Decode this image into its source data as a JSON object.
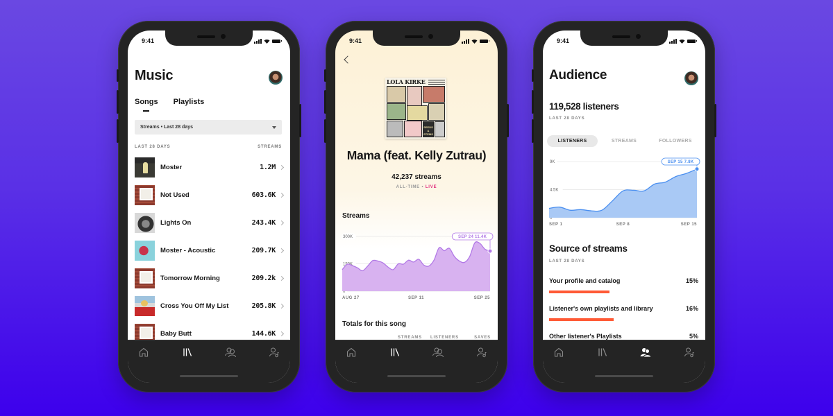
{
  "colors": {
    "accent_purple": "#b279e6",
    "accent_blue": "#4a8ff0",
    "accent_orange": "#ff5a36",
    "live_pink": "#e0287a",
    "tabbar": "#242424"
  },
  "status_bar": {
    "time": "9:41"
  },
  "tabbar_icons": [
    "home-icon",
    "library-icon",
    "audience-icon",
    "profile-icon"
  ],
  "music_screen": {
    "title": "Music",
    "tabs": [
      {
        "label": "Songs",
        "active": true
      },
      {
        "label": "Playlists",
        "active": false
      }
    ],
    "filter": {
      "value": "Streams • Last 28 days"
    },
    "list_header": {
      "left": "LAST 28 DAYS",
      "right": "STREAMS"
    },
    "songs": [
      {
        "name": "Moster",
        "streams": "1.2M"
      },
      {
        "name": "Not Used",
        "streams": "603.6K"
      },
      {
        "name": "Lights On",
        "streams": "243.4K"
      },
      {
        "name": "Moster - Acoustic",
        "streams": "209.7K"
      },
      {
        "name": "Tomorrow Morning",
        "streams": "209.2k"
      },
      {
        "name": "Cross You Off My List",
        "streams": "205.8K"
      },
      {
        "name": "Baby Butt",
        "streams": "144.6K"
      }
    ],
    "active_tab_index": 1
  },
  "song_screen": {
    "album_artist": "LOLA KIRKE",
    "album_cover_caption": "SEEDS & STEMS",
    "title": "Mama (feat. Kelly Zutrau)",
    "streams": "42,237 streams",
    "period": "ALL-TIME",
    "separator": " • ",
    "live": "LIVE",
    "section_streams": "Streams",
    "section_totals": "Totals for this song",
    "totals_columns": [
      "STREAMS",
      "LISTENERS",
      "SAVES"
    ],
    "active_tab_index": 1
  },
  "audience_screen": {
    "title": "Audience",
    "listeners": "119,528 listeners",
    "period": "LAST 28  DAYS",
    "tabs": [
      {
        "label": "LISTENERS",
        "active": true
      },
      {
        "label": "STREAMS",
        "active": false
      },
      {
        "label": "FOLLOWERS",
        "active": false
      }
    ],
    "source_title": "Source of streams",
    "source_period": "LAST 28 DAYS",
    "sources": [
      {
        "label": "Your profile and catalog",
        "percent": "15%",
        "value": 15
      },
      {
        "label": "Listener's own playlists and library",
        "percent": "16%",
        "value": 16
      },
      {
        "label": "Other listener's Playlists",
        "percent": "5%",
        "value": 5
      }
    ],
    "active_tab_index": 2
  },
  "chart_data": [
    {
      "type": "area",
      "title": "Streams",
      "x_tick_labels": [
        "AUG 27",
        "SEP 11",
        "SEP 25"
      ],
      "y_tick_labels": [
        "0",
        "150K",
        "300K"
      ],
      "ylim": [
        0,
        300000
      ],
      "tooltip": {
        "date": "SEP 24",
        "value": "11.4K"
      },
      "series": [
        {
          "name": "Streams",
          "color": "#b279e6",
          "x": [
            "Aug 27",
            "Aug 28",
            "Aug 29",
            "Aug 30",
            "Aug 31",
            "Sep 1",
            "Sep 2",
            "Sep 3",
            "Sep 4",
            "Sep 5",
            "Sep 6",
            "Sep 7",
            "Sep 8",
            "Sep 9",
            "Sep 10",
            "Sep 11",
            "Sep 12",
            "Sep 13",
            "Sep 14",
            "Sep 15",
            "Sep 16",
            "Sep 17",
            "Sep 18",
            "Sep 19",
            "Sep 20",
            "Sep 21",
            "Sep 22",
            "Sep 23",
            "Sep 24",
            "Sep 25"
          ],
          "values": [
            118000,
            148000,
            140000,
            128000,
            112000,
            138000,
            168000,
            165000,
            155000,
            132000,
            118000,
            150000,
            148000,
            170000,
            160000,
            175000,
            143000,
            138000,
            170000,
            238000,
            222000,
            235000,
            190000,
            165000,
            158000,
            190000,
            265000,
            262000,
            230000,
            220000
          ]
        }
      ]
    },
    {
      "type": "area",
      "title": "Listeners",
      "x_tick_labels": [
        "SEP 1",
        "SEP 8",
        "SEP 15"
      ],
      "y_tick_labels": [
        "0",
        "4.5K",
        "9K"
      ],
      "ylim": [
        0,
        9000
      ],
      "tooltip": {
        "date": "SEP 15",
        "value": "7.8K"
      },
      "series": [
        {
          "name": "Listeners",
          "color": "#4a8ff0",
          "x": [
            "Sep 1",
            "Sep 2",
            "Sep 3",
            "Sep 4",
            "Sep 5",
            "Sep 6",
            "Sep 7",
            "Sep 8",
            "Sep 9",
            "Sep 10",
            "Sep 11",
            "Sep 12",
            "Sep 13",
            "Sep 14",
            "Sep 15"
          ],
          "values": [
            1500,
            1700,
            1200,
            1300,
            1100,
            1200,
            2700,
            4300,
            4400,
            4300,
            5400,
            5700,
            6600,
            7100,
            7800
          ]
        }
      ]
    }
  ]
}
